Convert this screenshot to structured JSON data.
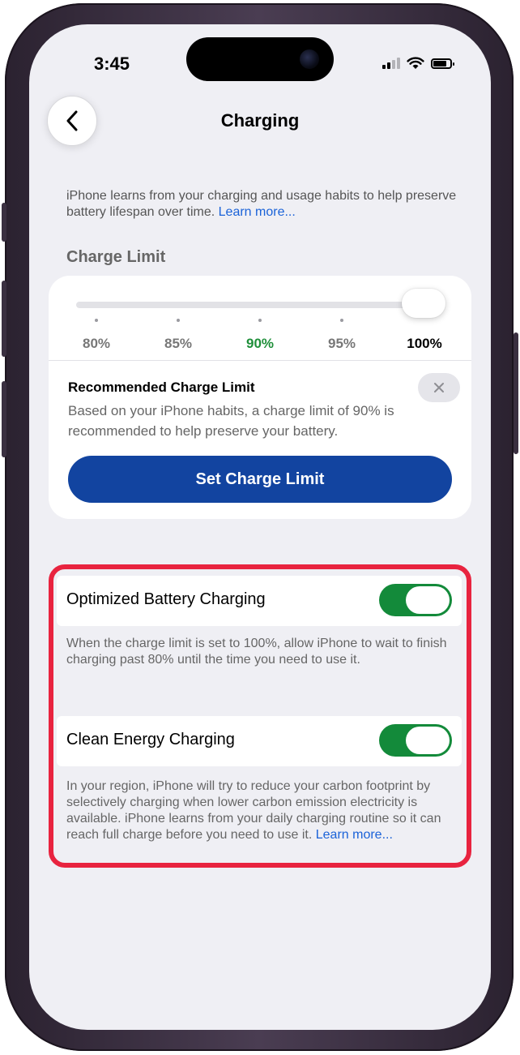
{
  "status_bar": {
    "time": "3:45",
    "signal_icon": "cellular-signal-icon",
    "wifi_icon": "wifi-icon",
    "battery_icon": "battery-icon"
  },
  "nav": {
    "title": "Charging",
    "back_icon": "chevron-left-icon"
  },
  "intro": {
    "text": "iPhone learns from your charging and usage habits to help preserve battery lifespan over time. ",
    "link": "Learn more..."
  },
  "charge_limit": {
    "section_title": "Charge Limit",
    "ticks": [
      "80%",
      "85%",
      "90%",
      "95%",
      "100%"
    ],
    "selected": "100%",
    "recommended": "90%",
    "recommendation_title": "Recommended Charge Limit",
    "recommendation_body": "Based on your iPhone habits, a charge limit of 90% is recommended to help preserve your battery.",
    "dismiss_icon": "close-icon",
    "set_button": "Set Charge Limit"
  },
  "optimized_charging": {
    "label": "Optimized Battery Charging",
    "enabled": true,
    "description": "When the charge limit is set to 100%, allow iPhone to wait to finish charging past 80% until the time you need to use it."
  },
  "clean_energy": {
    "label": "Clean Energy Charging",
    "enabled": true,
    "description": "In your region, iPhone will try to reduce your carbon footprint by selectively charging when lower carbon emission electricity is available. iPhone learns from your daily charging routine so it can reach full charge before you need to use it. ",
    "link": "Learn more..."
  },
  "colors": {
    "accent": "#1244a0",
    "toggle_on": "#138a3a",
    "highlight": "#e8233f",
    "recommended": "#1f8f3a"
  }
}
